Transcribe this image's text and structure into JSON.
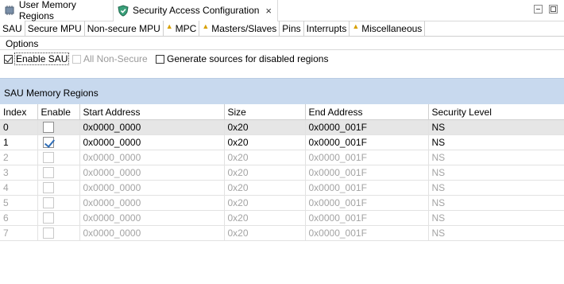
{
  "editor_tabs": [
    {
      "label": "User Memory Regions",
      "icon": "memory-chip-icon"
    },
    {
      "label": "Security Access Configuration",
      "icon": "shield-icon",
      "active": true,
      "close": "×"
    }
  ],
  "page_tabs": [
    {
      "label": "SAU",
      "warning": false,
      "active": true
    },
    {
      "label": "Secure MPU",
      "warning": false
    },
    {
      "label": "Non-secure MPU",
      "warning": false
    },
    {
      "label": "MPC",
      "warning": true
    },
    {
      "label": "Masters/Slaves",
      "warning": true
    },
    {
      "label": "Pins",
      "warning": false
    },
    {
      "label": "Interrupts",
      "warning": false
    },
    {
      "label": "Miscellaneous",
      "warning": true
    }
  ],
  "options": {
    "title": "Options",
    "enable_sau": {
      "label": "Enable SAU",
      "checked": true
    },
    "all_non_secure": {
      "label": "All Non-Secure",
      "checked": false,
      "disabled": true
    },
    "generate_sources": {
      "label": "Generate sources for disabled regions",
      "checked": false
    }
  },
  "section": {
    "title": "SAU Memory Regions"
  },
  "table": {
    "columns": [
      "Index",
      "Enable",
      "Start Address",
      "Size",
      "End Address",
      "Security Level"
    ],
    "rows": [
      {
        "index": "0",
        "enabled": false,
        "start": "0x0000_0000",
        "size": "0x20",
        "end": "0x0000_001F",
        "level": "NS",
        "state": "selected"
      },
      {
        "index": "1",
        "enabled": true,
        "start": "0x0000_0000",
        "size": "0x20",
        "end": "0x0000_001F",
        "level": "NS",
        "state": "normal"
      },
      {
        "index": "2",
        "enabled": false,
        "start": "0x0000_0000",
        "size": "0x20",
        "end": "0x0000_001F",
        "level": "NS",
        "state": "disabled"
      },
      {
        "index": "3",
        "enabled": false,
        "start": "0x0000_0000",
        "size": "0x20",
        "end": "0x0000_001F",
        "level": "NS",
        "state": "disabled"
      },
      {
        "index": "4",
        "enabled": false,
        "start": "0x0000_0000",
        "size": "0x20",
        "end": "0x0000_001F",
        "level": "NS",
        "state": "disabled"
      },
      {
        "index": "5",
        "enabled": false,
        "start": "0x0000_0000",
        "size": "0x20",
        "end": "0x0000_001F",
        "level": "NS",
        "state": "disabled"
      },
      {
        "index": "6",
        "enabled": false,
        "start": "0x0000_0000",
        "size": "0x20",
        "end": "0x0000_001F",
        "level": "NS",
        "state": "disabled"
      },
      {
        "index": "7",
        "enabled": false,
        "start": "0x0000_0000",
        "size": "0x20",
        "end": "0x0000_001F",
        "level": "NS",
        "state": "disabled"
      }
    ]
  },
  "colors": {
    "section_header": "#c8d9ee",
    "selected_row": "#e6e6e6",
    "warning": "#d8a000",
    "check": "#2f6db6"
  }
}
